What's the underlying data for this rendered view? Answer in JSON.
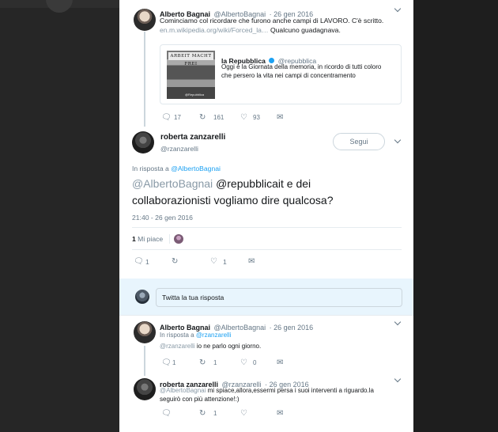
{
  "thread_top": {
    "author": "Alberto Bagnai",
    "handle": "@AlbertoBagnai",
    "date": "· 26 gen 2016",
    "text_line1": "Cominciamo col ricordare che furono anche campi di LAVORO. C'è scritto.",
    "link": "en.m.wikipedia.org/wiki/Forced_la…",
    "text_after_link": "Qualcuno guadagnava.",
    "quote": {
      "sign_text": "ARBEIT MACHT FREI",
      "image_watermark": "@Repubblica",
      "author": "la Repubblica",
      "verified_icon": "verified-badge",
      "handle": "@repubblica",
      "text_line1": "Oggi è la Giornata della memoria, in ricordo di tutti coloro",
      "text_line2": "che persero la vita nei campi di concentramento"
    },
    "replies": "17",
    "retweets": "161",
    "likes": "93"
  },
  "main_tweet": {
    "author": "roberta zanzarelli",
    "handle": "@rzanzarelli",
    "follow_label": "Segui",
    "in_reply_prefix": "In risposta a",
    "in_reply_handle": "@AlbertoBagnai",
    "mention": "@AlbertoBagnai",
    "text_rest_line1": "@repubblicait e dei",
    "text_line2": "collaborazionisti vogliamo dire qualcosa?",
    "timestamp": "21:40 - 26 gen 2016",
    "likes_count": "1",
    "likes_label": "Mi piace",
    "replies": "1",
    "retweets": "",
    "likes": "1"
  },
  "reply_box": {
    "placeholder": "Twitta la tua risposta"
  },
  "reply1": {
    "author": "Alberto Bagnai",
    "handle": "@AlbertoBagnai",
    "date": "· 26 gen 2016",
    "in_reply_prefix": "In risposta a",
    "in_reply_handle": "@rzanzarelli",
    "mention": "@rzanzarelli",
    "text": "io ne parlo ogni giorno.",
    "replies": "1",
    "retweets": "1",
    "likes": "0"
  },
  "reply2": {
    "author": "roberta zanzarelli",
    "handle": "@rzanzarelli",
    "date": "· 26 gen 2016",
    "mention": "@AlbertoBagnai",
    "text_line1": "mi spiace,allora,essermi persa i suoi interventi a riguardo.la",
    "text_line2": "seguirò con più attenzione!:)",
    "replies": "",
    "retweets": "1",
    "likes": ""
  },
  "icons": {
    "reply": "reply-icon",
    "retweet": "retweet-icon",
    "like": "heart-icon",
    "dm": "envelope-icon",
    "more": "chevron-down-icon"
  },
  "colors": {
    "link": "#1da1f2",
    "secondary": "#657786",
    "verified": "#1da1f2"
  }
}
